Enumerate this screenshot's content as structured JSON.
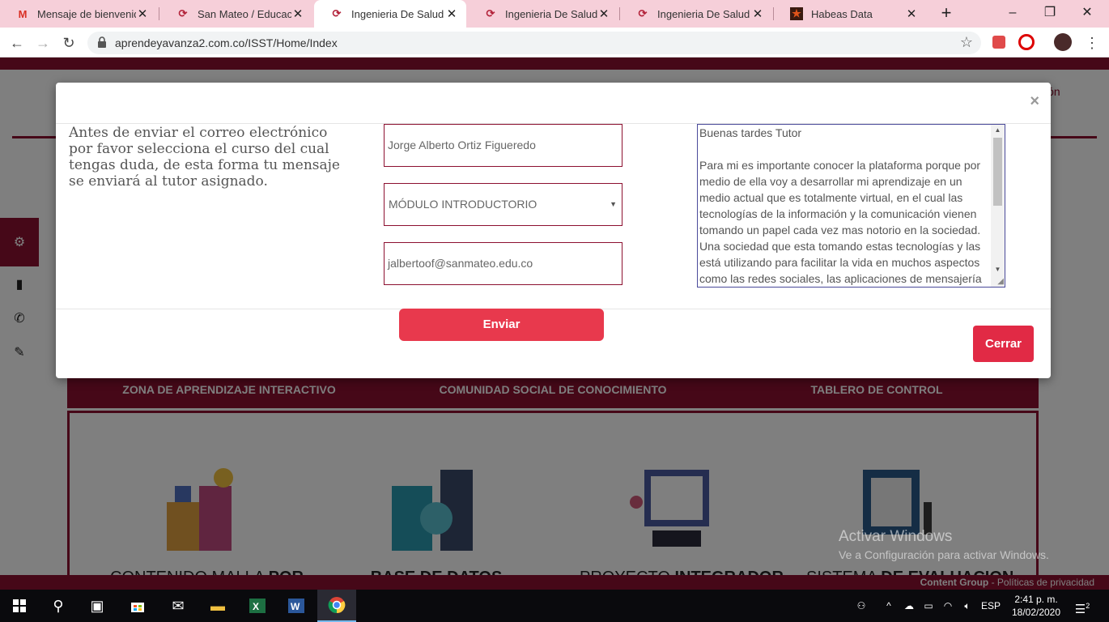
{
  "browser": {
    "tabs": [
      {
        "title": "Mensaje de bienvenida",
        "favicon": "gmail-icon",
        "active": false
      },
      {
        "title": "San Mateo / Educación",
        "favicon": "sanmateo-icon",
        "active": false
      },
      {
        "title": "Ingenieria De Salud",
        "favicon": "sanmateo-icon",
        "active": true
      },
      {
        "title": "Ingenieria De Salud",
        "favicon": "sanmateo-icon",
        "active": false
      },
      {
        "title": "Ingenieria De Salud",
        "favicon": "sanmateo-icon",
        "active": false
      },
      {
        "title": "Habeas Data",
        "favicon": "star-icon",
        "active": false
      }
    ],
    "url": "aprendeyavanza2.com.co/ISST/Home/Index"
  },
  "page": {
    "session_text": "sión",
    "menu": [
      "ZONA DE APRENDIZAJE INTERACTIVO",
      "COMUNIDAD SOCIAL DE CONOCIMIENTO",
      "TABLERO DE CONTROL"
    ],
    "cards": [
      {
        "pre": "CONTENIDO MALLA ",
        "bold": "POR"
      },
      {
        "pre": "",
        "bold": "BASE DE DATOS"
      },
      {
        "pre": "PROYECTO ",
        "bold": "INTEGRADOR"
      },
      {
        "pre": "SISTEMA ",
        "bold": "DE EVALUACION"
      }
    ],
    "footer_brand": "Content Group",
    "footer_text": " - Políticas de privacidad"
  },
  "modal": {
    "instructions": "Antes de enviar el correo electrónico por favor selecciona el curso del cual tengas duda, de esta forma tu mensaje se enviará al tutor asignado.",
    "name_value": "Jorge Alberto Ortiz Figueredo",
    "course_value": "MÓDULO INTRODUCTORIO",
    "email_value": "jalbertoof@sanmateo.edu.co",
    "message_value": "Buenas tardes Tutor\n\nPara mi es importante conocer la plataforma porque por medio de ella voy a desarrollar mi aprendizaje en un medio actual que es totalmente virtual, en el cual las tecnologías de la información y la comunicación vienen tomando un papel cada vez mas notorio en la sociedad. Una sociedad que esta tomando estas tecnologías y las está utilizando para facilitar la vida en muchos aspectos como las redes sociales, las aplicaciones de mensajería",
    "send_label": "Enviar",
    "close_label": "Cerrar",
    "close_x": "×"
  },
  "watermark": {
    "title": "Activar Windows",
    "subtitle": "Ve a Configuración para activar Windows."
  },
  "taskbar": {
    "language": "ESP",
    "time": "2:41 p. m.",
    "date": "18/02/2020",
    "notification_count": "2"
  },
  "colors": {
    "brand": "#8c1030",
    "send_button": "#e8394d",
    "close_button": "#e12a45"
  }
}
